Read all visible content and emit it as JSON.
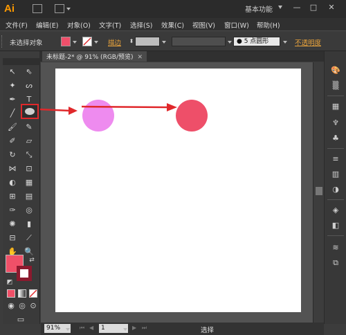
{
  "titlebar": {
    "logo": "Ai",
    "workspace": "基本功能",
    "minimize": "—",
    "restore": "□",
    "close": "✕"
  },
  "menu": [
    "文件(F)",
    "编辑(E)",
    "对象(O)",
    "文字(T)",
    "选择(S)",
    "效果(C)",
    "视图(V)",
    "窗口(W)",
    "帮助(H)"
  ],
  "control": {
    "selection_label": "未选择对象",
    "fill_color": "#ef4f6a",
    "stroke_label": "描边",
    "brush_label": "● 5 点圆形",
    "opacity_label": "不透明度"
  },
  "document": {
    "tab_title": "未标题-2* @ 91% (RGB/预览)",
    "close": "✕"
  },
  "artboard": {
    "circle_small_color": "#ee8bef",
    "circle_large_color": "#ee4f69",
    "arrow_color": "#e0282b"
  },
  "toolbox": {
    "fill_color": "#f05068",
    "stroke_color": "#8b1a2e",
    "highlight_color": "#e0282b"
  },
  "status": {
    "zoom": "91%",
    "page": "1",
    "tool_name": "选择"
  }
}
